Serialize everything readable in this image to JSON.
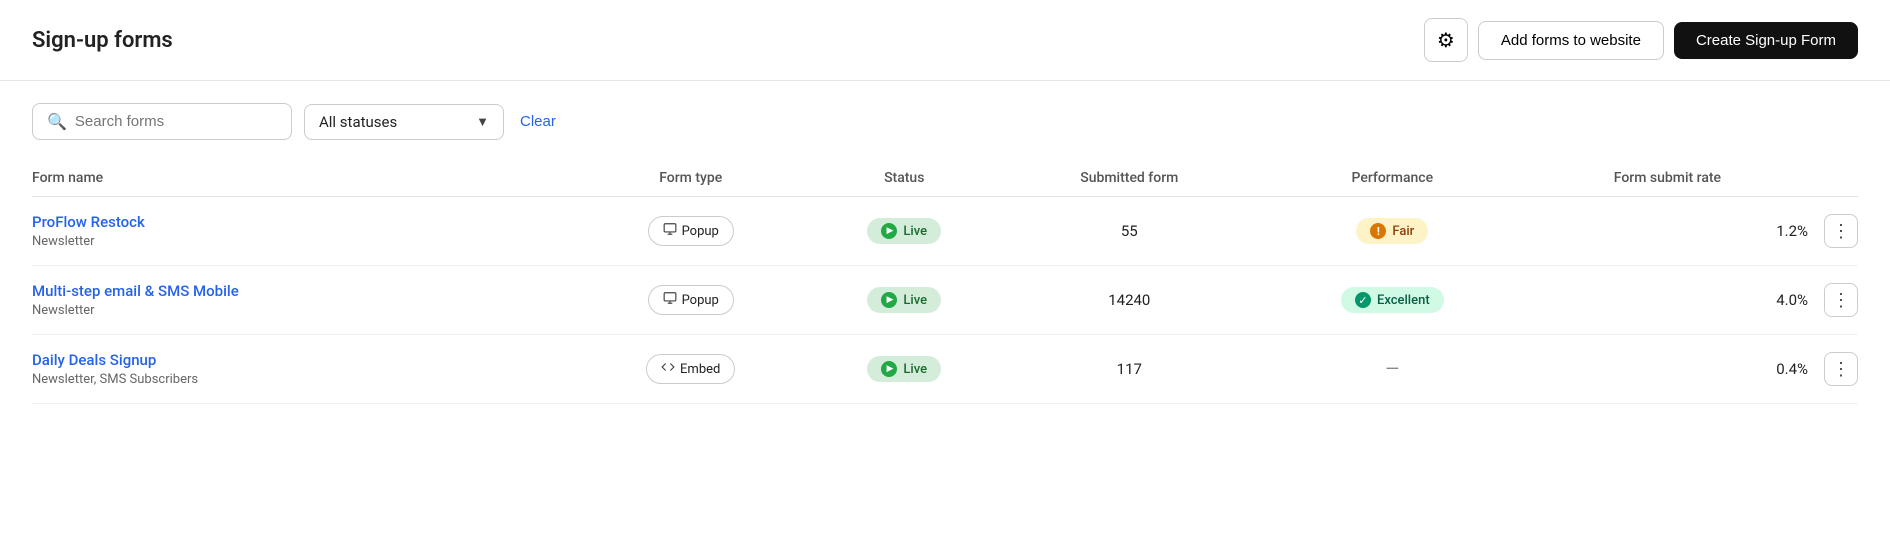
{
  "header": {
    "title": "Sign-up forms",
    "gear_label": "⚙",
    "add_forms_label": "Add forms to website",
    "create_form_label": "Create Sign-up Form"
  },
  "toolbar": {
    "search_placeholder": "Search forms",
    "status_label": "All statuses",
    "clear_label": "Clear"
  },
  "table": {
    "columns": {
      "form_name": "Form name",
      "form_type": "Form type",
      "status": "Status",
      "submitted_form": "Submitted form",
      "performance": "Performance",
      "form_submit_rate": "Form submit rate"
    },
    "rows": [
      {
        "name": "ProFlow Restock",
        "sub": "Newsletter",
        "type": "Popup",
        "status": "Live",
        "submitted": "55",
        "performance": "Fair",
        "performance_type": "fair",
        "submit_rate": "1.2%"
      },
      {
        "name": "Multi-step email & SMS Mobile",
        "sub": "Newsletter",
        "type": "Popup",
        "status": "Live",
        "submitted": "14240",
        "performance": "Excellent",
        "performance_type": "excellent",
        "submit_rate": "4.0%"
      },
      {
        "name": "Daily Deals Signup",
        "sub": "Newsletter, SMS Subscribers",
        "type": "Embed",
        "status": "Live",
        "submitted": "117",
        "performance": "—",
        "performance_type": "none",
        "submit_rate": "0.4%"
      }
    ]
  }
}
